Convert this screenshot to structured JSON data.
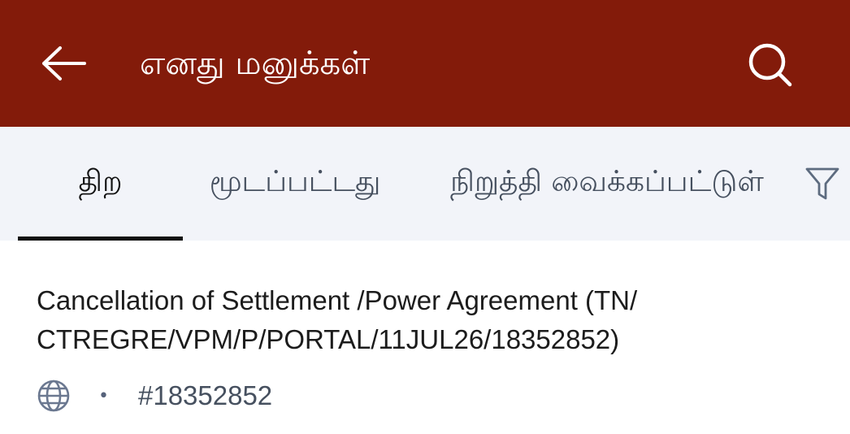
{
  "header": {
    "title": "எனது மனுக்கள்",
    "back_icon": "arrow-left-icon",
    "search_icon": "search-icon",
    "background_color": "#831b0a"
  },
  "tabs": [
    {
      "label": "திற",
      "active": true
    },
    {
      "label": "மூடப்பட்டது",
      "active": false
    },
    {
      "label": "நிறுத்தி வைக்கப்பட்டுள்",
      "active": false
    }
  ],
  "filter_icon": "filter-icon",
  "petitions": [
    {
      "title": "Cancellation of Settlement /Power Agreement (TN/ CTREGRE/VPM/P/PORTAL/11JUL26/18352852)",
      "source_icon": "globe-icon",
      "separator": "•",
      "number": "#18352852"
    }
  ]
}
